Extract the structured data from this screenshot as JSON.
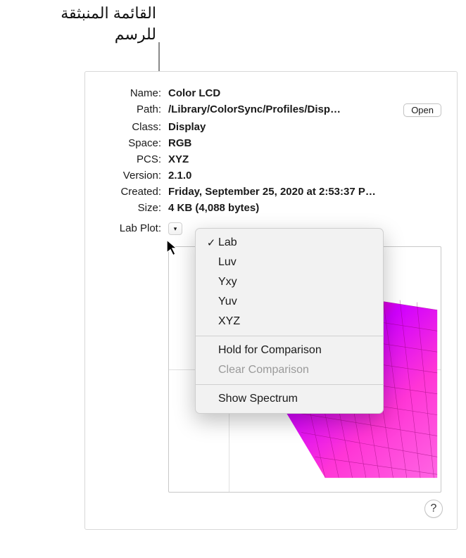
{
  "annotation": {
    "line1": "القائمة المنبثقة",
    "line2": "للرسم"
  },
  "info": {
    "name_label": "Name:",
    "name_value": "Color LCD",
    "path_label": "Path:",
    "path_value": "/Library/ColorSync/Profiles/Disp…",
    "open_label": "Open",
    "class_label": "Class:",
    "class_value": "Display",
    "space_label": "Space:",
    "space_value": "RGB",
    "pcs_label": "PCS:",
    "pcs_value": "XYZ",
    "version_label": "Version:",
    "version_value": "2.1.0",
    "created_label": "Created:",
    "created_value": "Friday, September 25, 2020 at 2:53:37 P…",
    "size_label": "Size:",
    "size_value": "4 KB (4,088 bytes)"
  },
  "plot": {
    "label": "Lab Plot:",
    "triangle": "▾"
  },
  "menu": {
    "items": [
      {
        "label": "Lab",
        "checked": true,
        "enabled": true
      },
      {
        "label": "Luv",
        "checked": false,
        "enabled": true
      },
      {
        "label": "Yxy",
        "checked": false,
        "enabled": true
      },
      {
        "label": "Yuv",
        "checked": false,
        "enabled": true
      },
      {
        "label": "XYZ",
        "checked": false,
        "enabled": true
      }
    ],
    "hold_label": "Hold for Comparison",
    "clear_label": "Clear Comparison",
    "spectrum_label": "Show Spectrum",
    "check_glyph": "✓"
  },
  "help": {
    "glyph": "?"
  }
}
